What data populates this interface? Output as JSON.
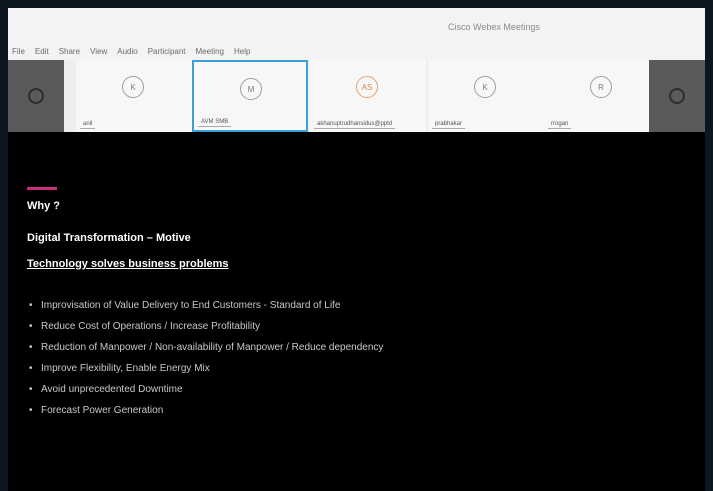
{
  "window": {
    "title": "Cisco Webex Meetings"
  },
  "menu": {
    "items": [
      "File",
      "Edit",
      "Share",
      "View",
      "Audio",
      "Participant",
      "Meeting",
      "Help"
    ]
  },
  "video_strip": {
    "tiles": [
      {
        "initials": "K",
        "name": "anil",
        "active": false,
        "accent": false
      },
      {
        "initials": "M",
        "name": "AVM SMB",
        "active": true,
        "accent": false
      },
      {
        "initials": "AS",
        "name": "akhanuptrudhansidus@pptd",
        "active": false,
        "accent": true
      },
      {
        "initials": "K",
        "name": "prabhakar",
        "active": false,
        "accent": false
      },
      {
        "initials": "R",
        "name": "rrogan",
        "active": false,
        "accent": false
      }
    ]
  },
  "slide": {
    "accent_color": "#c2307a",
    "heading": "Why ?",
    "subheading": "Digital Transformation – Motive",
    "tagline": "Technology solves business problems",
    "bullets": [
      "Improvisation of Value Delivery to End Customers - Standard of Life",
      "Reduce Cost of Operations / Increase Profitability",
      "Reduction of Manpower / Non-availability of Manpower / Reduce dependency",
      "Improve Flexibility, Enable Energy Mix",
      "Avoid unprecedented Downtime",
      "Forecast Power Generation"
    ]
  }
}
